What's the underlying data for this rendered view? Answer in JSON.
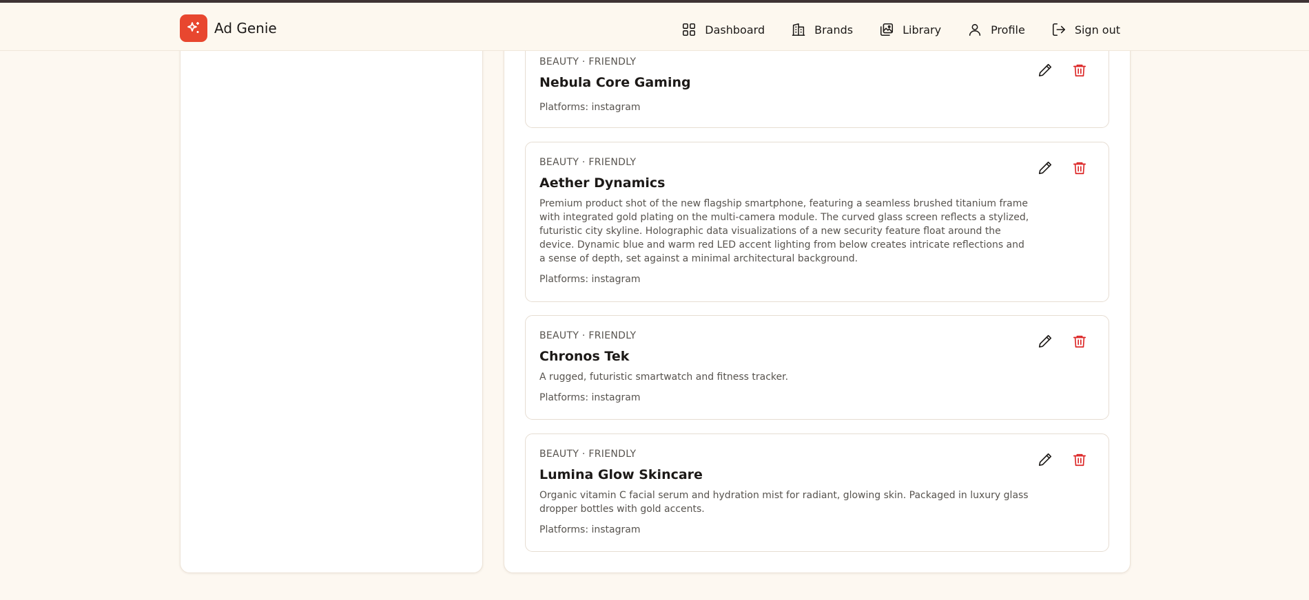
{
  "app": {
    "name": "Ad Genie",
    "accent": "#e8472f"
  },
  "nav": [
    {
      "label": "Dashboard",
      "icon": "dashboard-grid-icon"
    },
    {
      "label": "Brands",
      "icon": "building-icon"
    },
    {
      "label": "Library",
      "icon": "library-images-icon"
    },
    {
      "label": "Profile",
      "icon": "user-icon"
    },
    {
      "label": "Sign out",
      "icon": "sign-out-icon"
    }
  ],
  "brands": [
    {
      "meta": "BEAUTY · FRIENDLY",
      "name": "Nebula Core Gaming",
      "description": "",
      "platforms": "Platforms: instagram"
    },
    {
      "meta": "BEAUTY · FRIENDLY",
      "name": "Aether Dynamics",
      "description": "Premium product shot of the new flagship smartphone, featuring a seamless brushed titanium frame with integrated gold plating on the multi-camera module. The curved glass screen reflects a stylized, futuristic city skyline. Holographic data visualizations of a new security feature float around the device. Dynamic blue and warm red LED accent lighting from below creates intricate reflections and a sense of depth, set against a minimal architectural background.",
      "platforms": "Platforms: instagram"
    },
    {
      "meta": "BEAUTY · FRIENDLY",
      "name": "Chronos Tek",
      "description": "A rugged, futuristic smartwatch and fitness tracker.",
      "platforms": "Platforms: instagram"
    },
    {
      "meta": "BEAUTY · FRIENDLY",
      "name": "Lumina Glow Skincare",
      "description": "Organic vitamin C facial serum and hydration mist for radiant, glowing skin. Packaged in luxury glass dropper bottles with gold accents.",
      "platforms": "Platforms: instagram"
    }
  ],
  "icons": {
    "edit": "pencil-icon",
    "delete": "trash-icon",
    "delete_color": "#dc2626"
  }
}
